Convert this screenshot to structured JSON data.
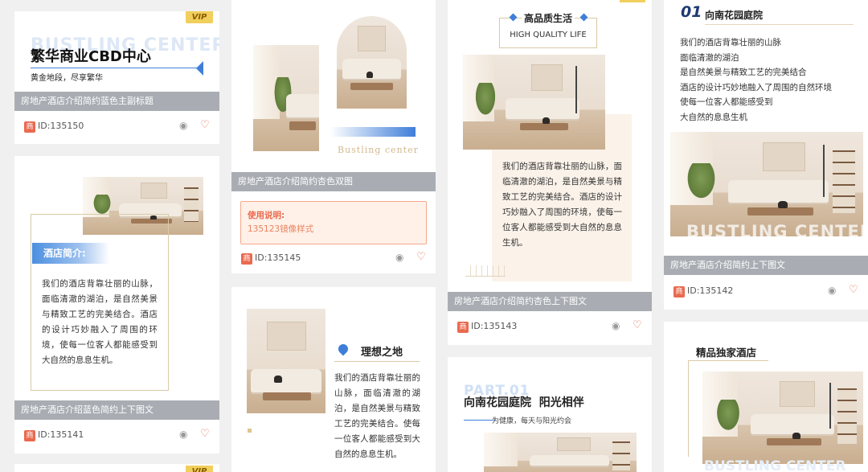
{
  "cards": {
    "c135150": {
      "vip": "VIP",
      "bg_text": "BUSTLING CENTER",
      "title": "繁华商业CBD中心",
      "subtitle": "黄金地段，尽享繁华",
      "caption": "房地产酒店介绍简约蓝色主副标题",
      "id": "ID:135150"
    },
    "c135141": {
      "tag": "酒店简介:",
      "text": "我们的酒店背靠壮丽的山脉，面临清澈的湖泊，是自然美景与精致工艺的完美结合。酒店的设计巧妙融入了周围的环境，使每一位客人都能感受到大自然的息息生机。",
      "caption": "房地产酒店介绍蓝色简约上下图文",
      "id": "ID:135141"
    },
    "c135141b": {
      "vip": "VIP"
    },
    "c135145": {
      "brand_text": "Bustling center",
      "caption": "房地产酒店介绍简约杏色双图",
      "usage_label": "使用说明:",
      "usage_value": "135123镜像样式",
      "id": "ID:135145"
    },
    "c_ideal": {
      "title": "理想之地",
      "text": "我们的酒店背靠壮丽的山脉，面临清澈的湖泊，是自然美景与精致工艺的完美结合。使每一位客人都能感受到大自然的息息生机。"
    },
    "c135143": {
      "title": "高品质生活",
      "subtitle": "HIGH QUALITY LIFE",
      "text": "我们的酒店背靠壮丽的山脉，面临清澈的湖泊，是自然美景与精致工艺的完美结合。酒店的设计巧妙融入了周围的环境，使每一位客人都能感受到大自然的息息生机。",
      "caption": "房地产酒店介绍简约杏色上下图文",
      "id": "ID:135143"
    },
    "c_part": {
      "part": "PART.01",
      "title": "向南花园庭院  阳光相伴",
      "subtitle": "为健康，每天与阳光约会"
    },
    "c135142": {
      "num": "01",
      "title": "向南花园庭院",
      "lines": [
        "我们的酒店背靠壮丽的山脉",
        "面临清澈的湖泊",
        "是自然美景与精致工艺的完美结合",
        "酒店的设计巧妙地融入了周围的自然环境",
        "使每一位客人都能感受到",
        "大自然的息息生机"
      ],
      "bg_text": "BUSTLING CENTER",
      "caption": "房地产酒店介绍简约上下图文",
      "id": "ID:135142"
    },
    "c_boutique": {
      "title": "精品独家酒店",
      "bg_text": "BUSTLING CENTER"
    }
  },
  "icons": {
    "brand": "商",
    "eye": "◉",
    "heart": "♡",
    "pin": "●"
  },
  "colors": {
    "accent_blue": "#3f7ed8",
    "brand_red": "#e96a4f",
    "caption_gray": "#a9adb3",
    "apricot": "#fbf3ea"
  }
}
